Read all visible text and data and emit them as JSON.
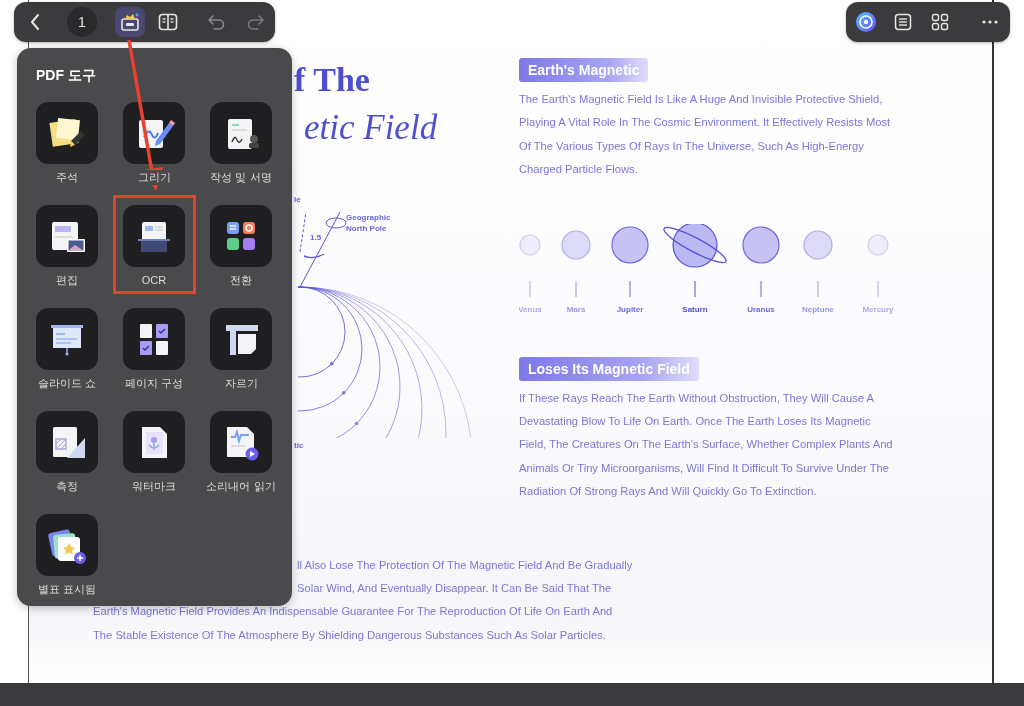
{
  "toolbar": {
    "items": [
      {
        "kind": "back",
        "selected": false
      },
      {
        "kind": "page",
        "label": "1",
        "selected": false
      },
      {
        "kind": "tools",
        "selected": true
      },
      {
        "kind": "reader",
        "selected": false
      },
      {
        "kind": "undo",
        "selected": false
      },
      {
        "kind": "redo",
        "selected": false
      }
    ]
  },
  "toolbar_right": {
    "items": [
      {
        "kind": "ai"
      },
      {
        "kind": "outline"
      },
      {
        "kind": "thumbnails"
      },
      {
        "kind": "more"
      }
    ]
  },
  "tools_panel": {
    "title": "PDF 도구",
    "tools": [
      {
        "kind": "annotate",
        "label": "주석",
        "highlighted": false
      },
      {
        "kind": "draw",
        "label": "그리기",
        "highlighted": false
      },
      {
        "kind": "sign",
        "label": "작성 및 서명",
        "highlighted": false
      },
      {
        "kind": "edit",
        "label": "편집",
        "highlighted": false
      },
      {
        "kind": "ocr",
        "label": "OCR",
        "highlighted": true
      },
      {
        "kind": "convert",
        "label": "전환",
        "highlighted": false
      },
      {
        "kind": "slideshow",
        "label": "슬라이드 쇼",
        "highlighted": false
      },
      {
        "kind": "organize",
        "label": "페이지 구성",
        "highlighted": false
      },
      {
        "kind": "crop",
        "label": "자르기",
        "highlighted": false
      },
      {
        "kind": "measure",
        "label": "측정",
        "highlighted": false
      },
      {
        "kind": "watermark",
        "label": "워터마크",
        "highlighted": false
      },
      {
        "kind": "read_aloud",
        "label": "소리내어 읽기",
        "highlighted": false
      },
      {
        "kind": "bookmark",
        "label": "별표 표시됨",
        "highlighted": false
      }
    ]
  },
  "document": {
    "title_lines": [
      "f The",
      "etic Field"
    ],
    "diagram_labels": {
      "top_fragment": "le",
      "pole_line_1": "Geographic",
      "pole_line_2": "North Pole",
      "angle": "1.5",
      "bottom_fragment": "tic"
    },
    "sections": [
      {
        "heading": "Earth's Magnetic",
        "lines": [
          "The Earth's Magnetic Field Is Like A Huge And Invisible Protective Shield,",
          "Playing A Vital Role In The Cosmic Environment. It Effectively Resists Most",
          "Of The Various Types Of Rays In The Universe, Such As High-Energy",
          "Charged Particle Flows."
        ]
      },
      {
        "heading": "Loses Its Magnetic Field",
        "lines": [
          "If These Rays Reach The Earth Without Obstruction, They Will Cause A",
          "Devastating Blow To Life On Earth. Once The Earth Loses Its Magnetic",
          "Field, The Creatures On The Earth's Surface, Whether Complex Plants And",
          "Animals Or Tiny Microorganisms, Will Find It Difficult To Survive Under The",
          "Radiation Of Strong Rays And Will Quickly Go To Extinction."
        ]
      }
    ],
    "planets": [
      {
        "name": "Venus",
        "ringed": false
      },
      {
        "name": "Mars",
        "ringed": false
      },
      {
        "name": "Jupiter",
        "ringed": false
      },
      {
        "name": "Saturn",
        "ringed": true
      },
      {
        "name": "Uranus",
        "ringed": false
      },
      {
        "name": "Neptune",
        "ringed": false
      },
      {
        "name": "Mercury",
        "ringed": false
      }
    ],
    "closing_partial_lines": [
      "ll Also Lose The Protection Of The Magnetic Field And Be Gradually",
      "Solar Wind, And Eventually Disappear. It Can Be Said That The"
    ],
    "closing_lines": [
      "Earth's Magnetic Field Provides An Indispensable Guarantee For The Reproduction Of Life On Earth And",
      "The Stable Existence Of The Atmosphere By Shielding Dangerous Substances Such As Solar Particles."
    ]
  }
}
